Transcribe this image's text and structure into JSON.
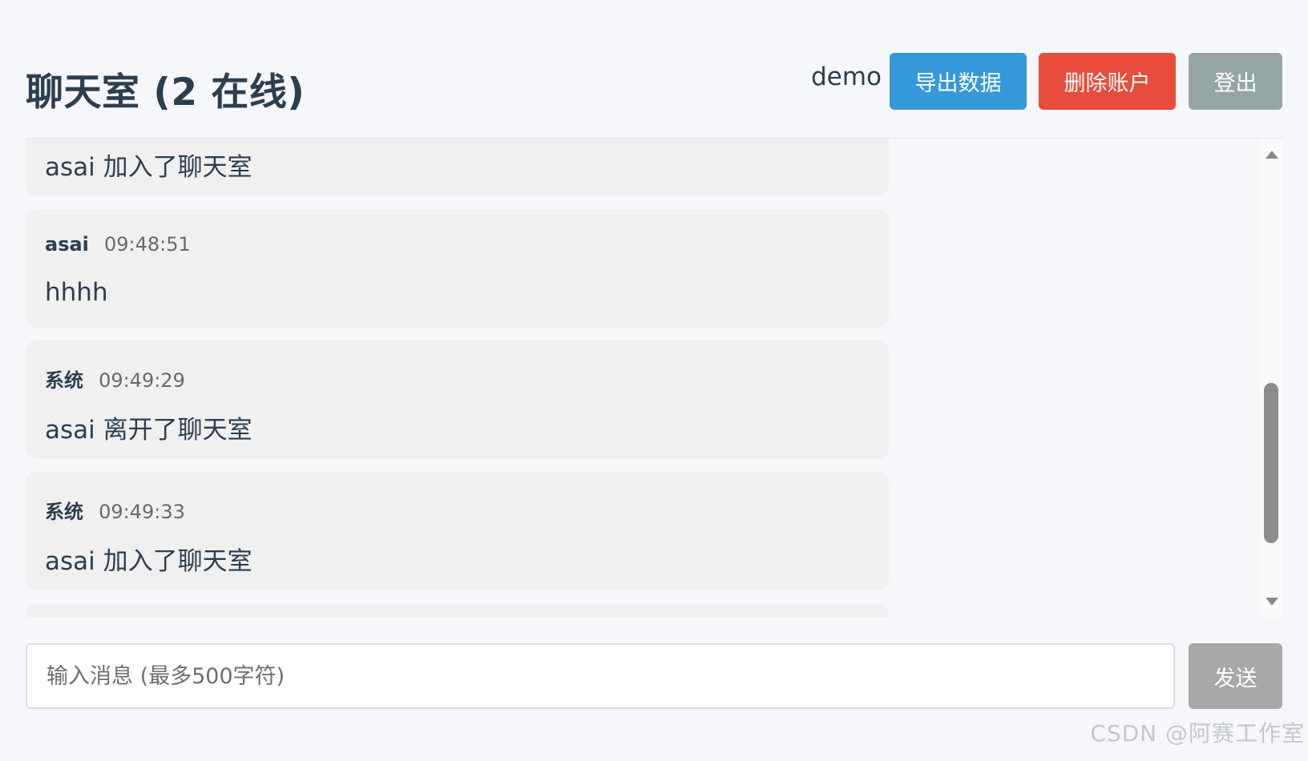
{
  "header": {
    "title": "聊天室 (2 在线)",
    "username": "demo",
    "export_label": "导出数据",
    "delete_label": "删除账户",
    "logout_label": "登出"
  },
  "messages": [
    {
      "sender": "",
      "time": "",
      "text": "asai 加入了聊天室"
    },
    {
      "sender": "asai",
      "time": "09:48:51",
      "text": "hhhh"
    },
    {
      "sender": "系统",
      "time": "09:49:29",
      "text": "asai 离开了聊天室"
    },
    {
      "sender": "系统",
      "time": "09:49:33",
      "text": "asai 加入了聊天室"
    },
    {
      "sender": "",
      "time": "",
      "text": ""
    }
  ],
  "composer": {
    "placeholder": "输入消息 (最多500字符)",
    "value": "",
    "send_label": "发送"
  },
  "watermark": "CSDN @阿赛工作室",
  "colors": {
    "title": "#2c3e50",
    "export_button": "#3498db",
    "delete_button": "#e74c3c",
    "logout_button": "#95a5a6",
    "send_button": "#a8a8a8",
    "message_bubble": "#f0f0f0",
    "page_background": "#f5f7fa"
  }
}
